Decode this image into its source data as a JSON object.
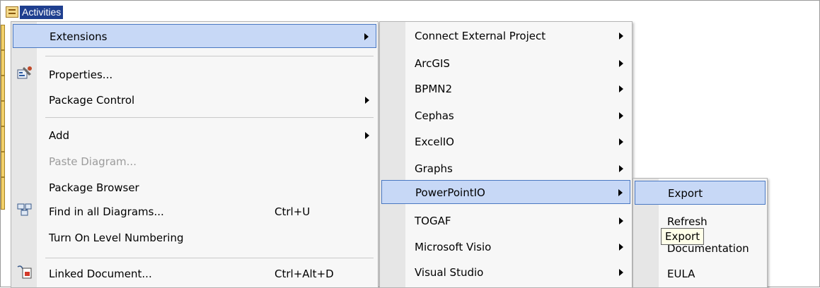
{
  "tree": {
    "title": "Activities",
    "icon": "package-tree-icon"
  },
  "main_menu": {
    "items": [
      {
        "label": "Extensions",
        "has_submenu": true,
        "highlighted": true
      },
      {
        "label": "Properties...",
        "icon": "properties-icon"
      },
      {
        "label": "Package Control",
        "has_submenu": true
      },
      {
        "label": "Add",
        "has_submenu": true
      },
      {
        "label": "Paste Diagram...",
        "disabled": true
      },
      {
        "label": "Package Browser"
      },
      {
        "label": "Find in all Diagrams...",
        "shortcut": "Ctrl+U",
        "icon": "find-diagrams-icon"
      },
      {
        "label": "Turn On Level Numbering"
      },
      {
        "label": "Linked Document...",
        "shortcut": "Ctrl+Alt+D",
        "icon": "linked-document-icon"
      }
    ]
  },
  "extensions_menu": {
    "items": [
      {
        "label": "Connect External Project",
        "has_submenu": true
      },
      {
        "label": "ArcGIS",
        "has_submenu": true
      },
      {
        "label": "BPMN2",
        "has_submenu": true
      },
      {
        "label": "Cephas",
        "has_submenu": true
      },
      {
        "label": "ExcelIO",
        "has_submenu": true
      },
      {
        "label": "Graphs",
        "has_submenu": true
      },
      {
        "label": "PowerPointIO",
        "has_submenu": true,
        "highlighted": true
      },
      {
        "label": "TOGAF",
        "has_submenu": true
      },
      {
        "label": "Microsoft Visio",
        "has_submenu": true
      },
      {
        "label": "Visual Studio",
        "has_submenu": true
      }
    ]
  },
  "powerpoint_menu": {
    "items": [
      {
        "label": "Export",
        "highlighted": true
      },
      {
        "label": "Refresh"
      },
      {
        "label": "Documentation"
      },
      {
        "label": "EULA"
      }
    ]
  },
  "tooltip": {
    "text": "Export"
  },
  "colors": {
    "highlight_bg": "#c7d8f6",
    "highlight_border": "#4a78c2",
    "title_bg": "#1f3f8f"
  }
}
